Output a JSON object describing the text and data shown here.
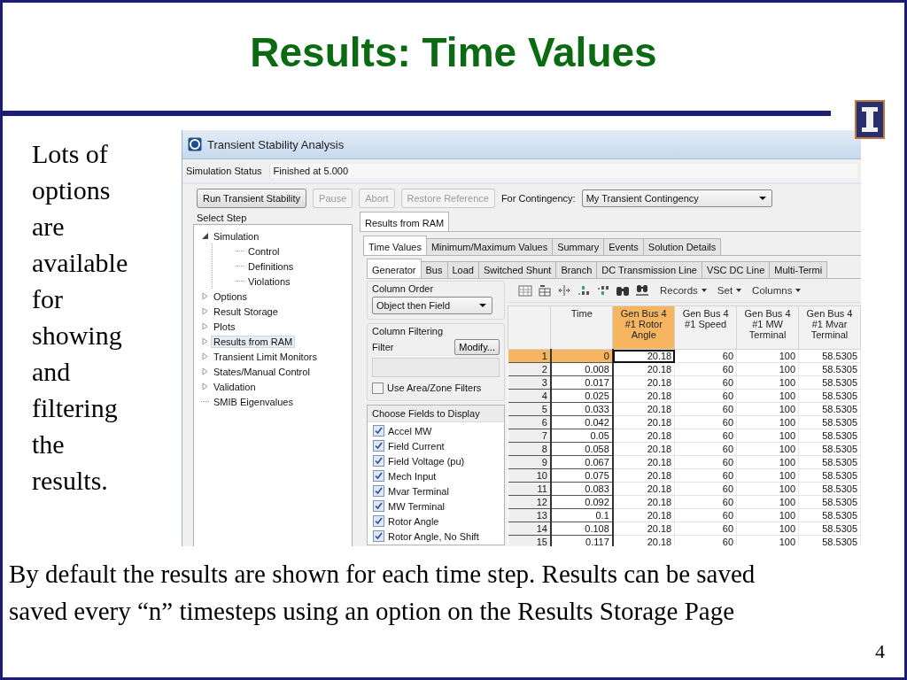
{
  "slide": {
    "title": "Results: Time Values",
    "side_lines": [
      "Lots of",
      "options",
      "are",
      "available",
      "for",
      "showing",
      "and",
      "filtering",
      "the",
      "results."
    ],
    "bottom_lines": [
      "By default the results are shown for each time step.  Results can be saved",
      "saved every “n” timesteps using an option on the Results Storage Page"
    ],
    "page_number": "4"
  },
  "app": {
    "window": {
      "title": "Transient Stability Analysis"
    },
    "status": {
      "label": "Simulation Status",
      "value": "Finished at 5.000"
    },
    "buttons": [
      {
        "label": "Run Transient Stability",
        "disabled": false
      },
      {
        "label": "Pause",
        "disabled": true
      },
      {
        "label": "Abort",
        "disabled": true
      },
      {
        "label": "Restore Reference",
        "disabled": true
      }
    ],
    "contingency": {
      "label": "For Contingency:",
      "value": "My Transient Contingency"
    },
    "select_step": {
      "title": "Select Step",
      "items": [
        {
          "label": "Simulation",
          "kind": "folder",
          "expanded": true,
          "selected": false,
          "children": [
            {
              "label": "Control",
              "kind": "leaf",
              "selected": false
            },
            {
              "label": "Definitions",
              "kind": "leaf",
              "selected": false
            },
            {
              "label": "Violations",
              "kind": "leaf",
              "selected": false
            }
          ]
        },
        {
          "label": "Options",
          "kind": "folder",
          "expanded": false,
          "selected": false
        },
        {
          "label": "Result Storage",
          "kind": "folder",
          "expanded": false,
          "selected": false
        },
        {
          "label": "Plots",
          "kind": "folder",
          "expanded": false,
          "selected": false
        },
        {
          "label": "Results from RAM",
          "kind": "folder",
          "expanded": false,
          "selected": true
        },
        {
          "label": "Transient Limit Monitors",
          "kind": "folder",
          "expanded": false,
          "selected": false
        },
        {
          "label": "States/Manual Control",
          "kind": "folder",
          "expanded": false,
          "selected": false
        },
        {
          "label": "Validation",
          "kind": "folder",
          "expanded": false,
          "selected": false
        },
        {
          "label": "SMIB Eigenvalues",
          "kind": "leaf",
          "selected": false
        }
      ]
    },
    "page_tabs": [
      {
        "label": "Results from RAM",
        "selected": true
      }
    ],
    "result_tabs": [
      {
        "label": "Time Values",
        "selected": true
      },
      {
        "label": "Minimum/Maximum Values",
        "selected": false
      },
      {
        "label": "Summary",
        "selected": false
      },
      {
        "label": "Events",
        "selected": false
      },
      {
        "label": "Solution Details",
        "selected": false
      }
    ],
    "object_tabs": [
      {
        "label": "Generator",
        "selected": true
      },
      {
        "label": "Bus",
        "selected": false
      },
      {
        "label": "Load",
        "selected": false
      },
      {
        "label": "Switched Shunt",
        "selected": false
      },
      {
        "label": "Branch",
        "selected": false
      },
      {
        "label": "DC Transmission Line",
        "selected": false
      },
      {
        "label": "VSC DC Line",
        "selected": false
      },
      {
        "label": "Multi-Termi",
        "selected": false
      }
    ],
    "column_order": {
      "title": "Column Order",
      "value": "Object then Field"
    },
    "column_filtering": {
      "title": "Column Filtering",
      "filter_label": "Filter",
      "button": "Modify...",
      "use_area_zone": {
        "label": "Use Area/Zone Filters",
        "checked": false
      }
    },
    "fields": {
      "title": "Choose Fields to Display",
      "items": [
        {
          "label": "Accel MW",
          "checked": true
        },
        {
          "label": "Field Current",
          "checked": true
        },
        {
          "label": "Field Voltage (pu)",
          "checked": true
        },
        {
          "label": "Mech Input",
          "checked": true
        },
        {
          "label": "Mvar Terminal",
          "checked": true
        },
        {
          "label": "MW Terminal",
          "checked": true
        },
        {
          "label": "Rotor Angle",
          "checked": true
        },
        {
          "label": "Rotor Angle, No Shift",
          "checked": true
        }
      ]
    },
    "toolbar": {
      "menus": [
        "Records",
        "Set",
        "Columns"
      ]
    },
    "table": {
      "columns": [
        {
          "label": "Time",
          "selected": false
        },
        {
          "label": "Gen Bus 4 #1 Rotor Angle",
          "selected": true
        },
        {
          "label": "Gen Bus 4 #1 Speed",
          "selected": false
        },
        {
          "label": "Gen Bus 4 #1 MW Terminal",
          "selected": false
        },
        {
          "label": "Gen Bus 4 #1 Mvar Terminal",
          "selected": false
        }
      ],
      "rows": [
        {
          "number": "1",
          "selected": true,
          "cells": [
            "0",
            "20.18",
            "60",
            "100",
            "58.5305"
          ]
        },
        {
          "number": "2",
          "selected": false,
          "cells": [
            "0.008",
            "20.18",
            "60",
            "100",
            "58.5305"
          ]
        },
        {
          "number": "3",
          "selected": false,
          "cells": [
            "0.017",
            "20.18",
            "60",
            "100",
            "58.5305"
          ]
        },
        {
          "number": "4",
          "selected": false,
          "cells": [
            "0.025",
            "20.18",
            "60",
            "100",
            "58.5305"
          ]
        },
        {
          "number": "5",
          "selected": false,
          "cells": [
            "0.033",
            "20.18",
            "60",
            "100",
            "58.5305"
          ]
        },
        {
          "number": "6",
          "selected": false,
          "cells": [
            "0.042",
            "20.18",
            "60",
            "100",
            "58.5305"
          ]
        },
        {
          "number": "7",
          "selected": false,
          "cells": [
            "0.05",
            "20.18",
            "60",
            "100",
            "58.5305"
          ]
        },
        {
          "number": "8",
          "selected": false,
          "cells": [
            "0.058",
            "20.18",
            "60",
            "100",
            "58.5305"
          ]
        },
        {
          "number": "9",
          "selected": false,
          "cells": [
            "0.067",
            "20.18",
            "60",
            "100",
            "58.5305"
          ]
        },
        {
          "number": "10",
          "selected": false,
          "cells": [
            "0.075",
            "20.18",
            "60",
            "100",
            "58.5305"
          ]
        },
        {
          "number": "11",
          "selected": false,
          "cells": [
            "0.083",
            "20.18",
            "60",
            "100",
            "58.5305"
          ]
        },
        {
          "number": "12",
          "selected": false,
          "cells": [
            "0.092",
            "20.18",
            "60",
            "100",
            "58.5305"
          ]
        },
        {
          "number": "13",
          "selected": false,
          "cells": [
            "0.1",
            "20.18",
            "60",
            "100",
            "58.5305"
          ]
        },
        {
          "number": "14",
          "selected": false,
          "cells": [
            "0.108",
            "20.18",
            "60",
            "100",
            "58.5305"
          ]
        },
        {
          "number": "15",
          "selected": false,
          "cells": [
            "0.117",
            "20.18",
            "60",
            "100",
            "58.5305"
          ]
        }
      ]
    }
  }
}
